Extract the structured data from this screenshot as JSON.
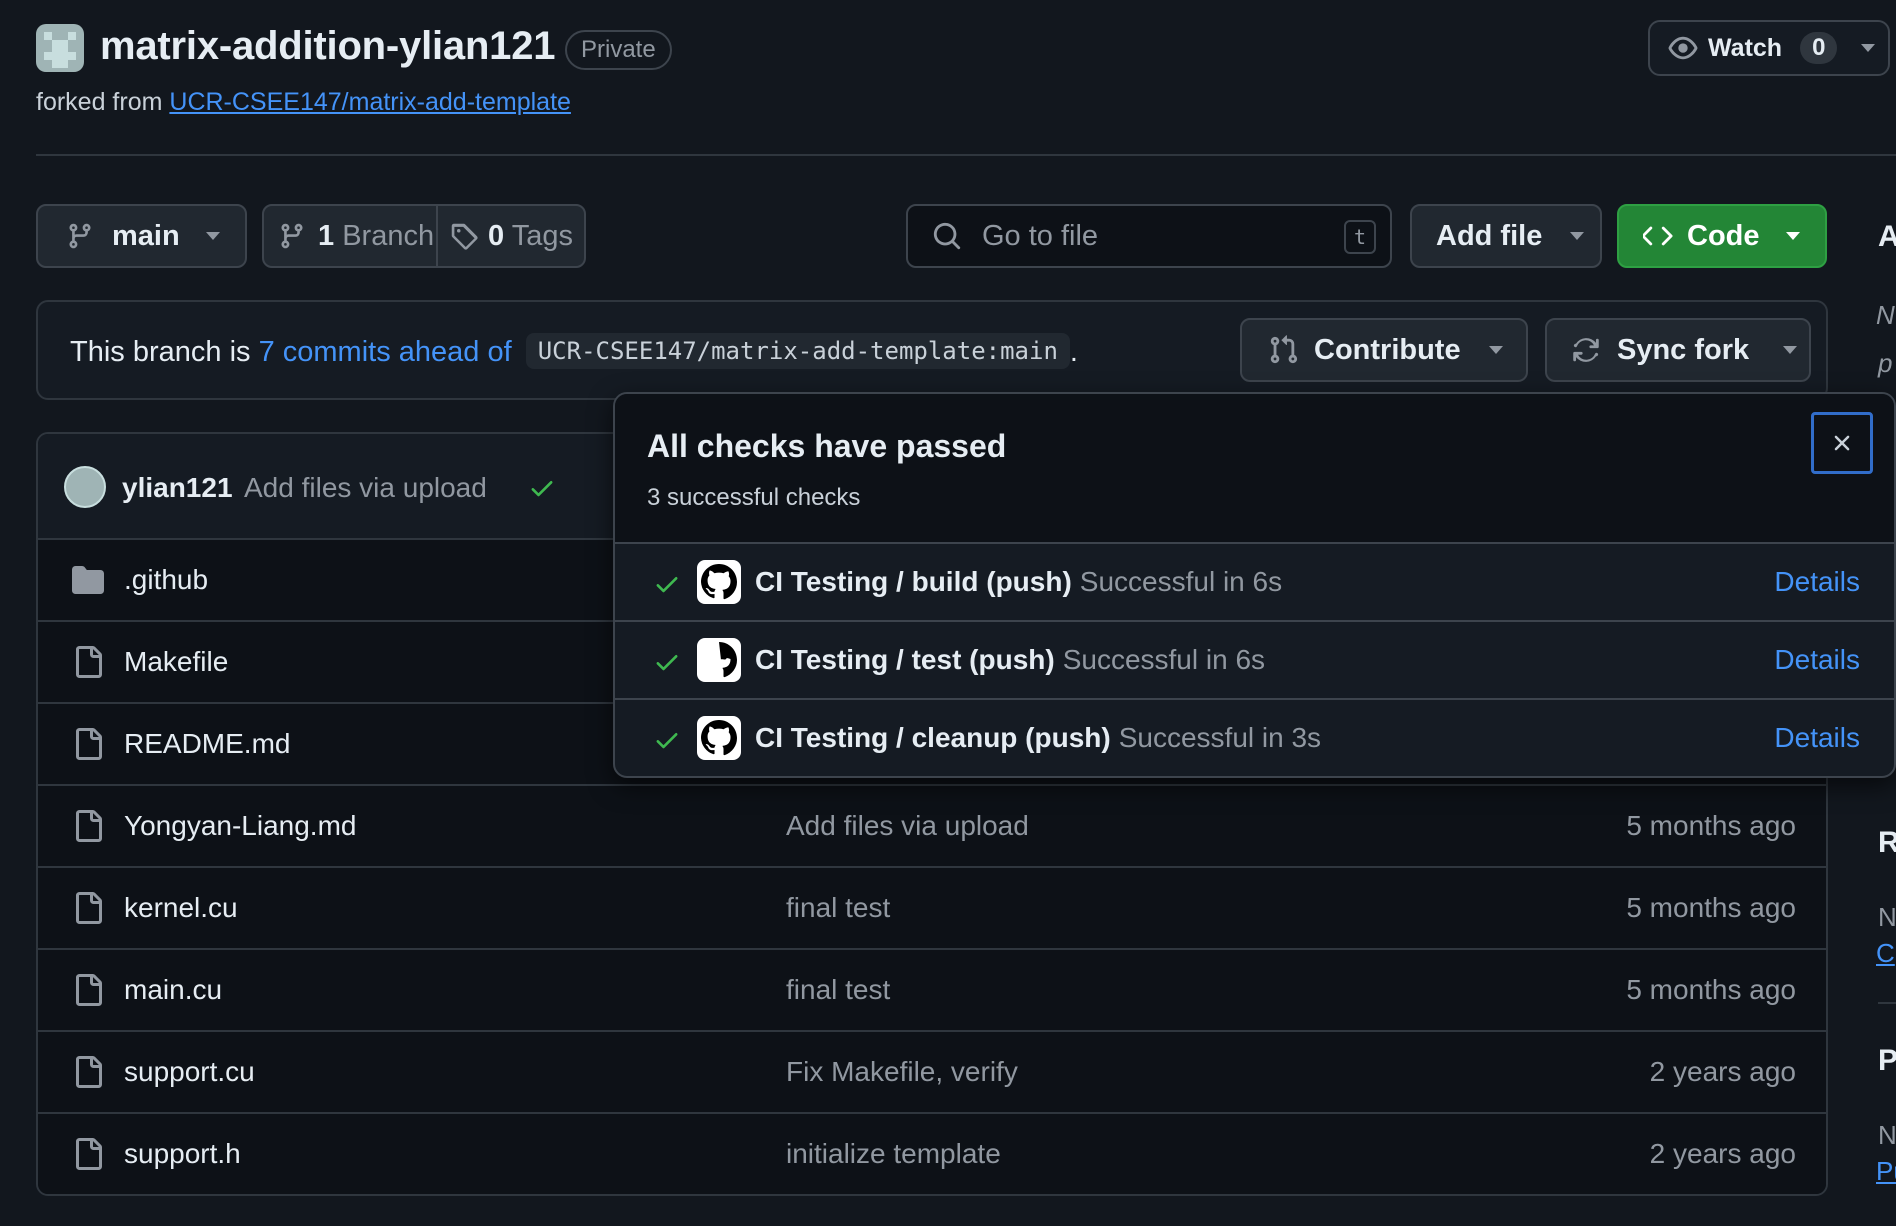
{
  "repo": {
    "name": "matrix-addition-ylian121",
    "visibility": "Private",
    "forked_prefix": "forked from",
    "forked_from": "UCR-CSEE147/matrix-add-template"
  },
  "watch": {
    "label": "Watch",
    "count": "0"
  },
  "toolbar": {
    "branch": "main",
    "branches_count": "1",
    "branches_label": "Branch",
    "tags_count": "0",
    "tags_label": "Tags",
    "search_placeholder": "Go to file",
    "search_shortcut": "t",
    "add_file": "Add file",
    "code": "Code"
  },
  "branch_status": {
    "prefix": "This branch is",
    "ahead_link": "7 commits ahead of",
    "base_ref": "UCR-CSEE147/matrix-add-template:main",
    "suffix": ".",
    "contribute": "Contribute",
    "sync_fork": "Sync fork"
  },
  "latest_commit": {
    "user": "ylian121",
    "message": "Add files via upload"
  },
  "files": [
    {
      "name": ".github",
      "type": "folder",
      "message": "",
      "time": ""
    },
    {
      "name": "Makefile",
      "type": "file",
      "message": "",
      "time": ""
    },
    {
      "name": "README.md",
      "type": "file",
      "message": "",
      "time": ""
    },
    {
      "name": "Yongyan-Liang.md",
      "type": "file",
      "message": "Add files via upload",
      "time": "5 months ago"
    },
    {
      "name": "kernel.cu",
      "type": "file",
      "message": "final test",
      "time": "5 months ago"
    },
    {
      "name": "main.cu",
      "type": "file",
      "message": "final test",
      "time": "5 months ago"
    },
    {
      "name": "support.cu",
      "type": "file",
      "message": "Fix Makefile, verify",
      "time": "2 years ago"
    },
    {
      "name": "support.h",
      "type": "file",
      "message": "initialize template",
      "time": "2 years ago"
    }
  ],
  "sidebar": {
    "heading_a": "A",
    "about_italic_1": "N",
    "about_italic_2": "p",
    "heading_r": "R",
    "releases_text": "N",
    "releases_link": "C",
    "heading_p": "P",
    "packages_text": "N",
    "packages_link": "Pu"
  },
  "checks_popover": {
    "title": "All checks have passed",
    "subtitle": "3 successful checks",
    "checks": [
      {
        "name": "CI Testing / build (push)",
        "status": "Successful in 6s",
        "details": "Details"
      },
      {
        "name": "CI Testing / test (push)",
        "status": "Successful in 6s",
        "details": "Details"
      },
      {
        "name": "CI Testing / cleanup (push)",
        "status": "Successful in 3s",
        "details": "Details"
      }
    ]
  },
  "colors": {
    "background": "#12171e",
    "link": "#4493f8",
    "success": "#3fb950",
    "code_button": "#238636",
    "muted_text": "#9198a1"
  }
}
